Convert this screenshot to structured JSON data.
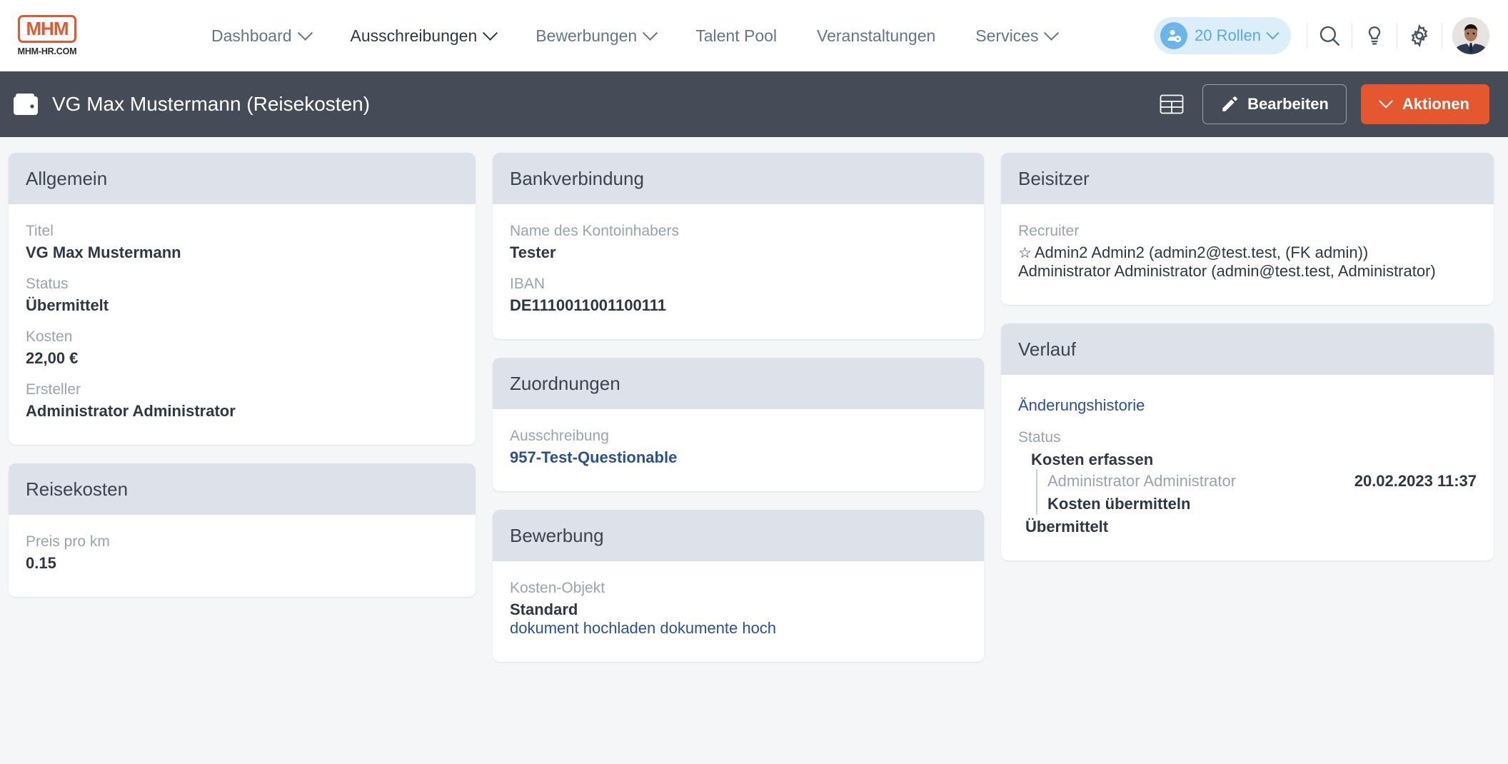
{
  "topnav": {
    "logo": {
      "text": "MHM",
      "subtext": "MHM-HR.COM"
    },
    "items": [
      {
        "label": "Dashboard",
        "has_chevron": true,
        "active": false,
        "icon": "chevron-down-icon"
      },
      {
        "label": "Ausschreibungen",
        "has_chevron": true,
        "active": true,
        "icon": "chevron-down-icon"
      },
      {
        "label": "Bewerbungen",
        "has_chevron": true,
        "active": false,
        "icon": "chevron-down-icon"
      },
      {
        "label": "Talent Pool",
        "has_chevron": false,
        "active": false,
        "icon": ""
      },
      {
        "label": "Veranstaltungen",
        "has_chevron": false,
        "active": false,
        "icon": ""
      },
      {
        "label": "Services",
        "has_chevron": true,
        "active": false,
        "icon": "chevron-down-icon"
      }
    ],
    "roles_badge": {
      "label": "20 Rollen",
      "icon": "user-gear-icon",
      "chevron": "chevron-down-icon"
    },
    "icons": [
      {
        "name": "search-icon"
      },
      {
        "name": "lightbulb-icon"
      },
      {
        "name": "gear-icon"
      }
    ],
    "avatar": {
      "name": "user-avatar"
    }
  },
  "subheader": {
    "icon": "wallet-icon",
    "title": "VG Max Mustermann (Reisekosten)",
    "table_icon": "table-view-icon",
    "edit_label": "Bearbeiten",
    "edit_icon": "pencil-icon",
    "actions_label": "Aktionen",
    "actions_icon": "chevron-down-icon"
  },
  "cards": {
    "allgemein": {
      "title": "Allgemein",
      "fields": [
        {
          "label": "Titel",
          "value": "VG Max Mustermann"
        },
        {
          "label": "Status",
          "value": "Übermittelt"
        },
        {
          "label": "Kosten",
          "value": "22,00 €"
        },
        {
          "label": "Ersteller",
          "value": "Administrator Administrator"
        }
      ]
    },
    "reisekosten": {
      "title": "Reisekosten",
      "fields": [
        {
          "label": "Preis pro km",
          "value": "0.15"
        }
      ]
    },
    "bankverbindung": {
      "title": "Bankverbindung",
      "fields": [
        {
          "label": "Name des Kontoinhabers",
          "value": "Tester"
        },
        {
          "label": "IBAN",
          "value": "DE1110011001100111"
        }
      ]
    },
    "zuordnungen": {
      "title": "Zuordnungen",
      "label": "Ausschreibung",
      "link": "957-Test-Questionable"
    },
    "bewerbung": {
      "title": "Bewerbung",
      "label": "Kosten-Objekt",
      "value": "Standard",
      "link": "dokument hochladen dokumente hoch"
    },
    "beisitzer": {
      "title": "Beisitzer",
      "label": "Recruiter",
      "entries": [
        {
          "star": "☆",
          "text": "Admin2 Admin2 (admin2@test.test, (FK admin))"
        },
        {
          "star": "",
          "text": "Administrator Administrator (admin@test.test, Administrator)"
        }
      ]
    },
    "verlauf": {
      "title": "Verlauf",
      "history_link": "Änderungshistorie",
      "status_label": "Status",
      "step": "Kosten erfassen",
      "user": "Administrator Administrator",
      "date": "20.02.2023 11:37",
      "substep": "Kosten übermitteln",
      "final": "Übermittelt"
    }
  },
  "colors": {
    "brand_orange": "#e5572e",
    "dark_bar": "#454c58",
    "card_header": "#dde1e9",
    "link_blue": "#2a5196",
    "muted": "#9aa3b0",
    "page_bg": "#f5f6f8"
  }
}
